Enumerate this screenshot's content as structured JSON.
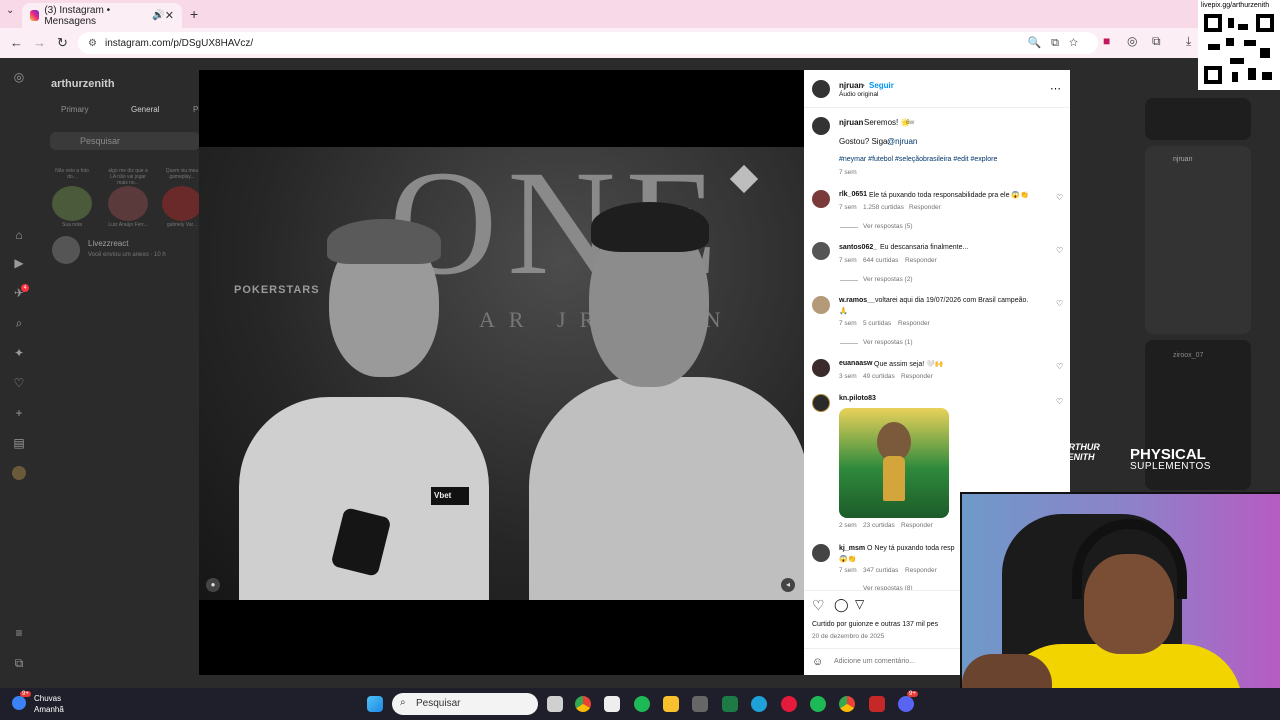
{
  "browser": {
    "tab_title": "(3) Instagram • Mensagens",
    "url": "instagram.com/p/DSgUX8HAVcz/"
  },
  "background": {
    "dm_user": "arthurzenith",
    "dm_tabs": [
      "Primary",
      "General",
      "Pe"
    ],
    "search_placeholder": "Pesquisar",
    "story_notes": [
      "Não veio a foto do...",
      "algo me diz que a LA não vai jogar mais no...",
      "Quem viu meu gameplay..."
    ],
    "story_names": [
      "Sua nota",
      "Luiz Araújo Ferr...",
      "gabriely Var..."
    ],
    "conversation_name": "Livezzreact",
    "conversation_sub": "Você enviou um anexo · 10 h",
    "feed_user": "njruan",
    "feed_user2": "ziroox_07",
    "notif_count": "4"
  },
  "video": {
    "brand_text": "POKERSTARS",
    "wall_text": "ONE",
    "wall_sub": "AR JR E ON",
    "shirt_logo": "Vbet"
  },
  "post": {
    "author": "njruan",
    "follow_label": "Seguir",
    "audio": "Áudio original",
    "caption_user": "njruan",
    "caption_text": "Seremos! 🌟",
    "caption_time": "6w",
    "caption_line2": "Gostou? Siga:",
    "caption_mention": "@njruan",
    "hashtags": "#neymar #futebol #seleçãobrasileira #edit #explore",
    "caption_age": "7 sem",
    "comments": [
      {
        "user": "rlk_0651",
        "text": "Ele tá puxando toda responsabilidade pra ele 😱👏",
        "age": "7 sem",
        "likes": "1.258 curtidas",
        "reply": "Responder",
        "replies": "Ver respostas (5)"
      },
      {
        "user": "santos062_",
        "text": "Eu descansaria finalmente...",
        "age": "7 sem",
        "likes": "644 curtidas",
        "reply": "Responder",
        "replies": "Ver respostas (2)"
      },
      {
        "user": "w.ramos__",
        "text": "voltarei aqui dia 19/07/2026 com Brasil campeão.",
        "text2": "🙏",
        "age": "7 sem",
        "likes": "5 curtidas",
        "reply": "Responder",
        "replies": "Ver respostas (1)"
      },
      {
        "user": "euanaasw",
        "text": "Que assim seja! 🤍🙌",
        "age": "3 sem",
        "likes": "49 curtidas",
        "reply": "Responder"
      },
      {
        "user": "kn.piloto83",
        "text": "",
        "age": "2 sem",
        "likes": "23 curtidas",
        "reply": "Responder"
      },
      {
        "user": "kj_msm",
        "text": "O Ney tá puxando toda resp",
        "text2": "😱👏",
        "age": "7 sem",
        "likes": "347 curtidas",
        "reply": "Responder",
        "replies": "Ver respostas (8)"
      }
    ],
    "liked_by": "Curtido por guionze e outras 137 mil pes",
    "date": "20 de dezembro de 2025",
    "comment_placeholder": "Adicione um comentário..."
  },
  "overlay": {
    "qr_url": "livepix.gg/arthurzenith",
    "sponsor_line1": "PHYSICAL",
    "sponsor_line2": "SUPLEMENTOS",
    "streamer_logo": "ARTHUR ZENITH"
  },
  "taskbar": {
    "weather_title": "Chuvas",
    "weather_sub": "Amanhã",
    "weather_badge": "9+",
    "search_label": "Pesquisar",
    "discord_badge": "9+"
  }
}
